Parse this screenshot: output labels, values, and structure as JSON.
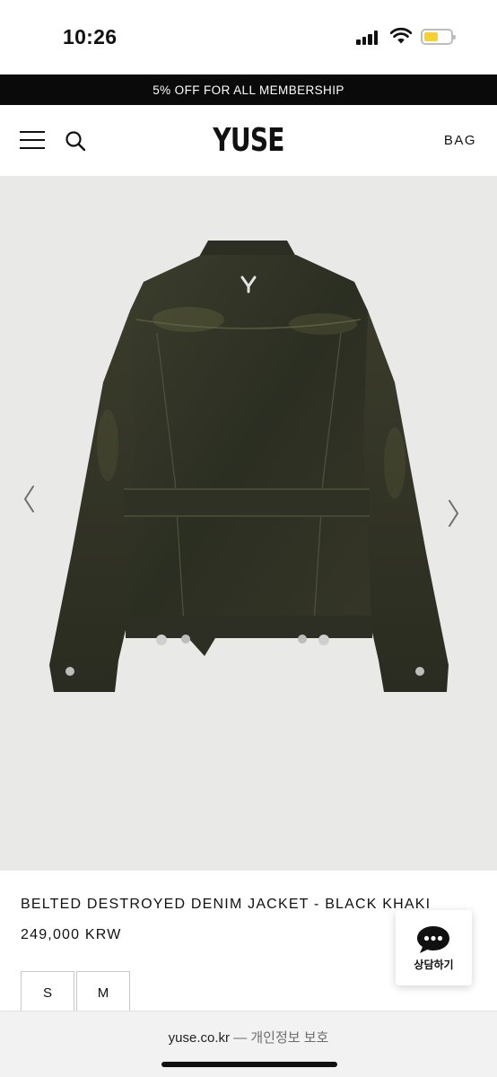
{
  "status_bar": {
    "time": "10:26"
  },
  "promo_banner": {
    "text": "5% OFF FOR ALL MEMBERSHIP"
  },
  "header": {
    "logo": "YUSE",
    "bag_label": "BAG",
    "icons": [
      "menu-icon",
      "search-icon"
    ]
  },
  "gallery": {
    "icons": [
      "chevron-left-icon",
      "chevron-right-icon"
    ],
    "image_subject": "denim-jacket-back-view",
    "background_color": "#e9e9e7"
  },
  "product": {
    "name": "BELTED DESTROYED DENIM JACKET - BLACK KHAKI",
    "price": "249,000 KRW",
    "sizes": [
      "S",
      "M"
    ]
  },
  "chat_widget": {
    "label": "상담하기",
    "icon": "chat-bubble-icon"
  },
  "browser_bar": {
    "domain": "yuse.co.kr",
    "separator": "—",
    "privacy_text": "개인정보 보호"
  },
  "colors": {
    "banner_bg": "#0a0a0a",
    "battery_fill": "#f7d12e",
    "jacket": "#2f3224"
  }
}
